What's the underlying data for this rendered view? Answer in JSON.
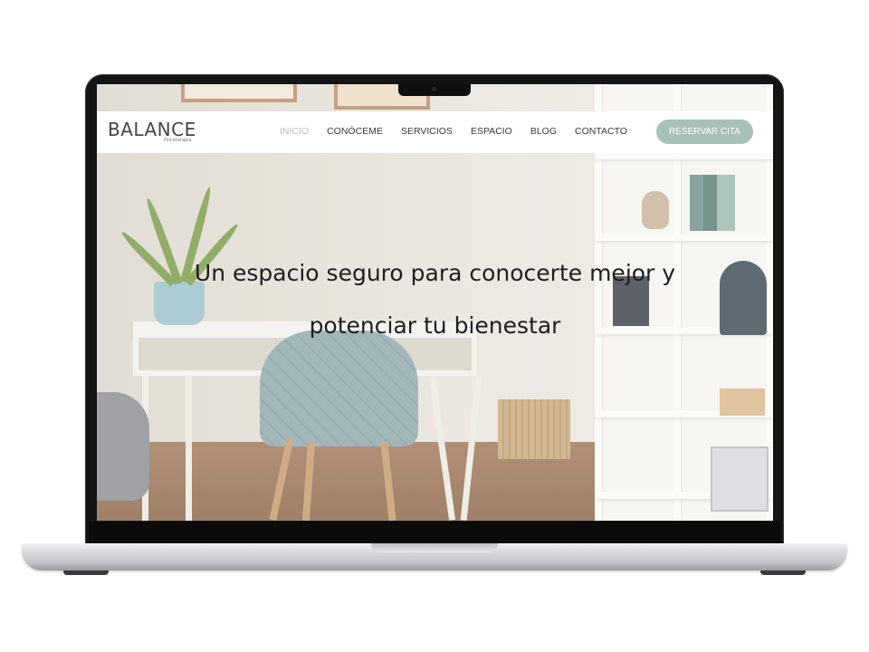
{
  "site": {
    "logo": "BALANCE",
    "logo_sub": "Psicoterapia",
    "nav": [
      "INICIO",
      "CONÓCEME",
      "SERVICIOS",
      "ESPACIO",
      "BLOG",
      "CONTACTO"
    ],
    "active_nav": "INICIO",
    "cta_label": "RESERVAR CITA",
    "cta_color": "#a9c0b6"
  },
  "hero": {
    "title_line1": "Un espacio seguro para conocerte mejor y",
    "title_line2": "potenciar tu bienestar"
  },
  "device": {
    "type": "laptop-mockup"
  }
}
